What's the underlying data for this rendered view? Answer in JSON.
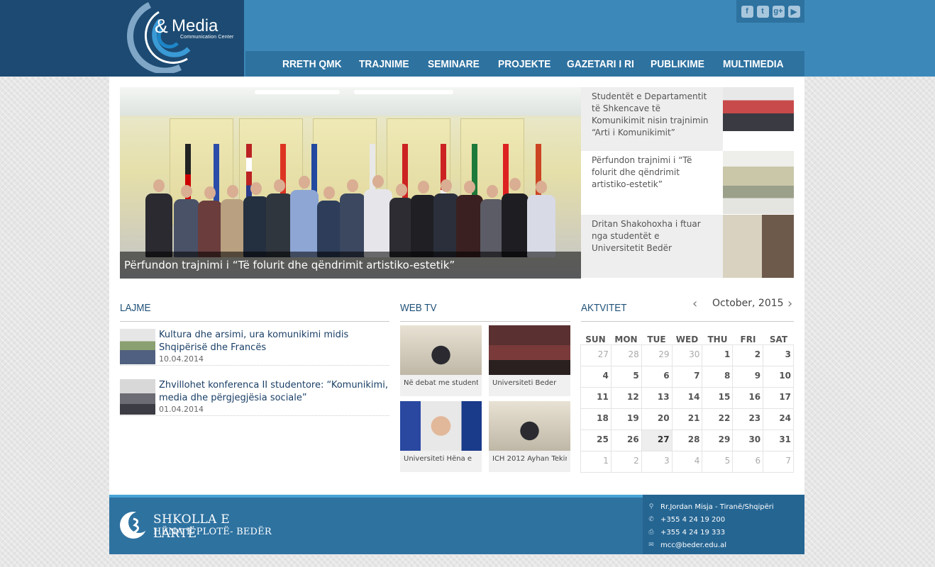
{
  "logo": {
    "amp": "&",
    "name": "Media",
    "subtitle": "Communication Center"
  },
  "social": [
    {
      "icon": "facebook-icon",
      "glyph": "f"
    },
    {
      "icon": "twitter-icon",
      "glyph": "t"
    },
    {
      "icon": "google-plus-icon",
      "glyph": "g+"
    },
    {
      "icon": "youtube-icon",
      "glyph": "▶"
    }
  ],
  "nav": [
    "RRETH QMK",
    "TRAJNIME",
    "SEMINARE",
    "PROJEKTE",
    "GAZETARI I RI",
    "PUBLIKIME",
    "MULTIMEDIA"
  ],
  "slider": {
    "caption": "Përfundon trajnimi i “Të folurit dhe qëndrimit artistiko-estetik”"
  },
  "side_news": [
    "Studentët e Departamentit të Shkencave të Komunikimit nisin trajnimin “Arti i Komunikimit”",
    "Përfundon trajnimi i “Të folurit dhe qëndrimit artistiko-estetik”",
    "Dritan Shakohoxha i ftuar nga studentët e Universitetit Bedër"
  ],
  "sections": {
    "news": "LAJME",
    "webtv": "WEB TV",
    "activities": "AKTVITET"
  },
  "news": [
    {
      "title": "Kultura dhe arsimi, ura komunikimi midis Shqipërisë dhe Francës",
      "date": "10.04.2014"
    },
    {
      "title": "Zhvillohet konferenca II studentore: “Komunikimi, media dhe përgjegjësia sociale”",
      "date": "01.04.2014"
    }
  ],
  "webtv": [
    "Në debat me student",
    "Universiteti Beder",
    "Universiteti Hëna e",
    "ICH 2012 Ayhan Tekin"
  ],
  "calendar": {
    "month": "October, 2015",
    "prev": "‹",
    "next": "›",
    "weekdays": [
      "SUN",
      "MON",
      "TUE",
      "WED",
      "THU",
      "FRI",
      "SAT"
    ],
    "weeks": [
      [
        [
          "27",
          true
        ],
        [
          "28",
          true
        ],
        [
          "29",
          true
        ],
        [
          "30",
          true
        ],
        [
          "1",
          false
        ],
        [
          "2",
          false
        ],
        [
          "3",
          false
        ]
      ],
      [
        [
          "4",
          false
        ],
        [
          "5",
          false
        ],
        [
          "6",
          false
        ],
        [
          "7",
          false
        ],
        [
          "8",
          false
        ],
        [
          "9",
          false
        ],
        [
          "10",
          false
        ]
      ],
      [
        [
          "11",
          false
        ],
        [
          "12",
          false
        ],
        [
          "13",
          false
        ],
        [
          "14",
          false
        ],
        [
          "15",
          false
        ],
        [
          "16",
          false
        ],
        [
          "17",
          false
        ]
      ],
      [
        [
          "18",
          false
        ],
        [
          "19",
          false
        ],
        [
          "20",
          false
        ],
        [
          "21",
          false
        ],
        [
          "22",
          false
        ],
        [
          "23",
          false
        ],
        [
          "24",
          false
        ]
      ],
      [
        [
          "25",
          false
        ],
        [
          "26",
          false
        ],
        [
          "27",
          false
        ],
        [
          "28",
          false
        ],
        [
          "29",
          false
        ],
        [
          "30",
          false
        ],
        [
          "31",
          false
        ]
      ],
      [
        [
          "1",
          true
        ],
        [
          "2",
          true
        ],
        [
          "3",
          true
        ],
        [
          "4",
          true
        ],
        [
          "5",
          true
        ],
        [
          "6",
          true
        ],
        [
          "7",
          true
        ]
      ]
    ],
    "today": "27"
  },
  "footer": {
    "logo_line1": "SHKOLLA E LARTË",
    "logo_line2": "HËNA E PLOTË- BEDËR",
    "contact": [
      {
        "icon": "location-icon",
        "glyph": "⚲",
        "text": "Rr.Jordan Misja - Tiranë/Shqipëri"
      },
      {
        "icon": "phone-icon",
        "glyph": "✆",
        "text": "+355 4 24 19 200"
      },
      {
        "icon": "fax-icon",
        "glyph": "⎙",
        "text": "+355 4 24 19 333"
      },
      {
        "icon": "email-icon",
        "glyph": "✉",
        "text": "mcc@beder.edu.al"
      }
    ]
  },
  "colors": {
    "header": "#3c89b9",
    "logo_band": "#1c4a72",
    "nav": "#2e72a0",
    "footer_accent": "#48a3d5",
    "title_text": "#1f5178"
  }
}
